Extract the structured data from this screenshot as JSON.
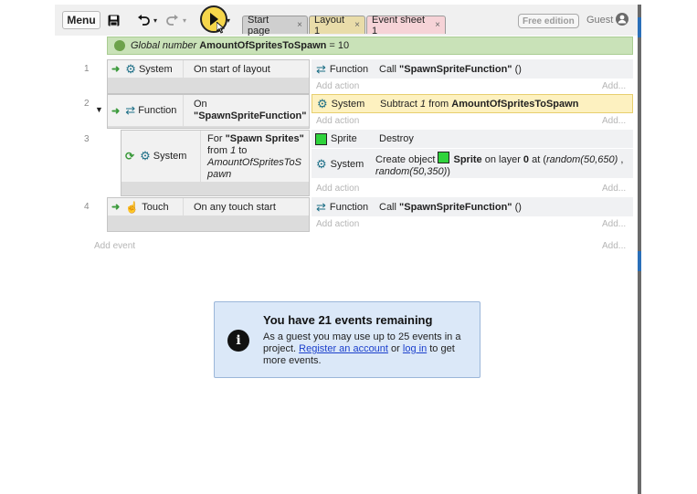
{
  "toolbar": {
    "menu_label": "Menu",
    "tabs": [
      {
        "label": "Start page",
        "close": "×",
        "color": "#cfcfcf"
      },
      {
        "label": "Layout 1",
        "close": "×",
        "color": "#e9dca9"
      },
      {
        "label": "Event sheet 1",
        "close": "×",
        "color": "#f6d3d7"
      }
    ],
    "free_edition": "Free edition",
    "guest_label": "Guest"
  },
  "global_var": {
    "prefix": "Global number",
    "name": "AmountOfSpritesToSpawn",
    "value": "= 10"
  },
  "events": [
    {
      "number": "1",
      "conditions": [
        {
          "object": "System",
          "text": "On start of layout"
        }
      ],
      "actions": [
        {
          "object": "Function",
          "pre": "Call ",
          "bold": "\"SpawnSpriteFunction\"",
          "post": " ()"
        }
      ]
    },
    {
      "number": "2",
      "conditions": [
        {
          "object": "Function",
          "line1": "On",
          "line2": "\"SpawnSpriteFunction\""
        }
      ],
      "actions": [
        {
          "object": "System",
          "pre": "Subtract ",
          "ital": "1",
          "mid": " from ",
          "bold": "AmountOfSpritesToSpawn"
        }
      ]
    },
    {
      "number": "3",
      "conditions": [
        {
          "object": "System",
          "l1a": "For ",
          "l1b": "\"Spawn Sprites\"",
          "l2a": "from ",
          "l2b": "1",
          "l2c": " to",
          "l3": "AmountOfSpritesToS",
          "l4": "pawn"
        }
      ],
      "actions": [
        {
          "object": "Sprite",
          "text": "Destroy"
        },
        {
          "object": "System",
          "pre": "Create object ",
          "bold": "Sprite",
          "mid": " on layer ",
          "bold2": "0",
          "at": " at (",
          "ital": "random(50,650)",
          "sep": " ,",
          "ital2": "random(50,350)",
          "post": ")"
        }
      ]
    },
    {
      "number": "4",
      "conditions": [
        {
          "object": "Touch",
          "text": "On any touch start"
        }
      ],
      "actions": [
        {
          "object": "Function",
          "pre": "Call ",
          "bold": "\"SpawnSpriteFunction\"",
          "post": " ()"
        }
      ]
    }
  ],
  "add_action": "Add action",
  "add_dots": "Add...",
  "add_event": "Add event",
  "dialog": {
    "title": "You have 21 events remaining",
    "text1": "As a guest you may use up to 25 events in a project. ",
    "link1": "Register an account",
    "text2": " or ",
    "link2": "log in",
    "text3": " to get more events."
  },
  "colors": {
    "selected_action": "#fdf1c0",
    "condition_header": "#dcdcdc",
    "action_bg": "#eef0f3"
  }
}
